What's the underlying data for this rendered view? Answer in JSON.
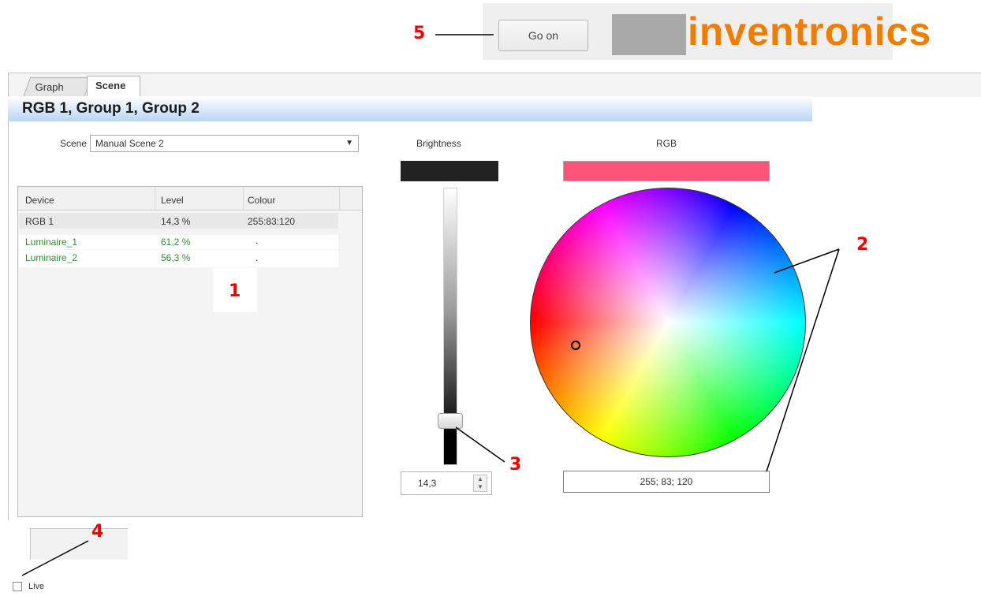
{
  "toolbar": {
    "go_on_label": "Go on"
  },
  "brand": {
    "logo_text": "inventronics",
    "logo_color": "#f07d00"
  },
  "tabs": [
    {
      "label": "Graph",
      "active": false
    },
    {
      "label": "Scene",
      "active": true
    }
  ],
  "panel": {
    "title": "RGB 1, Group 1, Group 2"
  },
  "scene": {
    "label": "Scene",
    "selected": "Manual Scene 2"
  },
  "table": {
    "headers": [
      "Device",
      "Level",
      "Colour"
    ],
    "rows": [
      {
        "device": "RGB 1",
        "level": "14,3 %",
        "colour": "255:83:120"
      },
      {
        "device": "Luminaire_1",
        "level": "61,2 %",
        "colour": "."
      },
      {
        "device": "Luminaire_2",
        "level": "56,3 %",
        "colour": "."
      }
    ]
  },
  "brightness": {
    "label": "Brightness",
    "value": "14,3",
    "swatch_color": "#222222"
  },
  "rgb": {
    "label": "RGB",
    "value": "255; 83; 120",
    "swatch_color": "#ff5378"
  },
  "live": {
    "label": "Live",
    "checked": false
  },
  "callouts": [
    "1",
    "2",
    "3",
    "4",
    "5"
  ]
}
